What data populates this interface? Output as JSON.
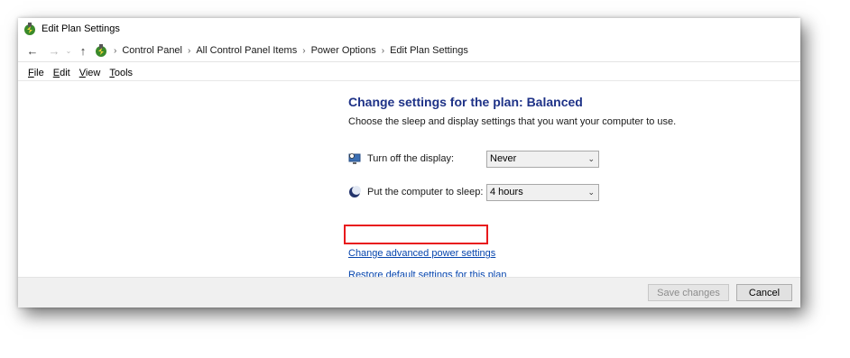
{
  "window": {
    "title": "Edit Plan Settings"
  },
  "nav": {
    "back_icon": "arrow-left-icon",
    "forward_icon": "arrow-right-icon",
    "recent_icon": "chevron-down-icon",
    "up_icon": "arrow-up-icon",
    "breadcrumbs": [
      "Control Panel",
      "All Control Panel Items",
      "Power Options",
      "Edit Plan Settings"
    ]
  },
  "menu": {
    "items": [
      "File",
      "Edit",
      "View",
      "Tools"
    ]
  },
  "main": {
    "heading": "Change settings for the plan: Balanced",
    "subtext": "Choose the sleep and display settings that you want your computer to use.",
    "display": {
      "label": "Turn off the display:",
      "value": "Never"
    },
    "sleep": {
      "label": "Put the computer to sleep:",
      "value": "4 hours"
    },
    "links": {
      "advanced": "Change advanced power settings",
      "restore": "Restore default settings for this plan"
    }
  },
  "footer": {
    "save_label": "Save changes",
    "cancel_label": "Cancel"
  },
  "colors": {
    "heading": "#1e3287",
    "link": "#0645ad",
    "highlight": "#e8191c"
  }
}
